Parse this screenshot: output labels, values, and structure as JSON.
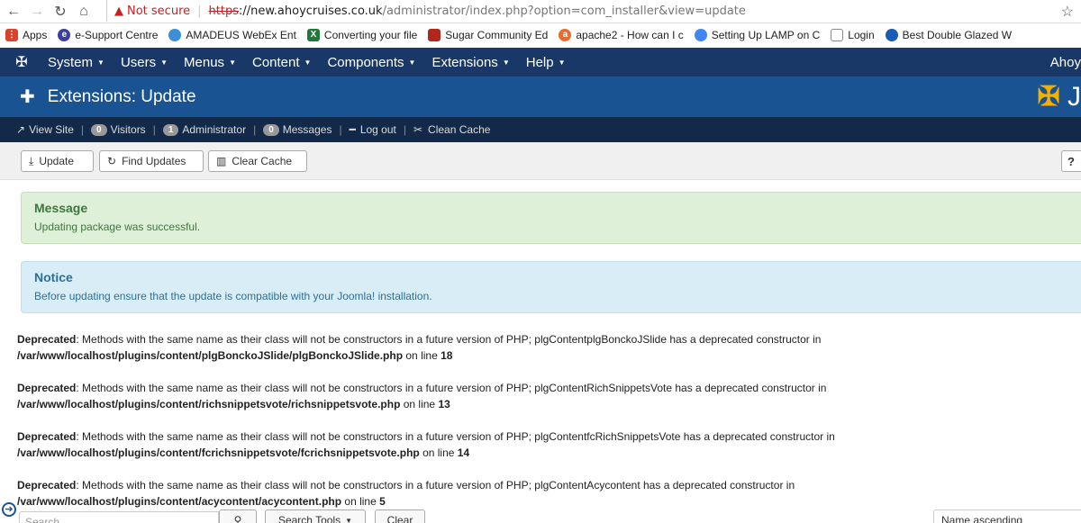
{
  "browser": {
    "security_label": "Not secure",
    "url_scheme": "https",
    "url_host": "://new.ahoycruises.co.uk",
    "url_path": "/administrator/index.php?option=com_installer&view=update"
  },
  "bookmarks": [
    {
      "label": "Apps",
      "icon": "apps-grid-icon",
      "color": "#d9432e"
    },
    {
      "label": "e-Support Centre",
      "icon": "e-icon",
      "color": "#3b3fa0"
    },
    {
      "label": "AMADEUS WebEx Ent",
      "icon": "webex-icon",
      "color": "#3a8fd6"
    },
    {
      "label": "Converting your file",
      "icon": "excel-icon",
      "color": "#1f7a3a"
    },
    {
      "label": "Sugar Community Ed",
      "icon": "sugar-icon",
      "color": "#b3261e"
    },
    {
      "label": "apache2 - How can I c",
      "icon": "askubuntu-icon",
      "color": "#e96c2b"
    },
    {
      "label": "Setting Up LAMP on C",
      "icon": "google-icon",
      "color": "#4285f4"
    },
    {
      "label": "Login",
      "icon": "page-icon",
      "color": "#ffffff"
    },
    {
      "label": "Best Double Glazed W",
      "icon": "eco-icon",
      "color": "#1a5bb5"
    }
  ],
  "topnav": {
    "items": [
      "System",
      "Users",
      "Menus",
      "Content",
      "Components",
      "Extensions",
      "Help"
    ],
    "right": "Ahoy"
  },
  "header": {
    "title": "Extensions: Update",
    "brand_letter": "J"
  },
  "status": {
    "view_site": "View Site",
    "visitors_count": "0",
    "visitors": "Visitors",
    "admin_count": "1",
    "administrator": "Administrator",
    "messages_count": "0",
    "messages": "Messages",
    "logout": "Log out",
    "clean_cache": "Clean Cache"
  },
  "toolbar": {
    "update": "Update",
    "find_updates": "Find Updates",
    "clear_cache": "Clear Cache"
  },
  "alerts": {
    "message_title": "Message",
    "message_text": "Updating package was successful.",
    "notice_title": "Notice",
    "notice_text": "Before updating ensure that the update is compatible with your Joomla! installation."
  },
  "deprecations": [
    {
      "label": "Deprecated",
      "text": ": Methods with the same name as their class will not be constructors in a future version of PHP; plgContentplgBonckoJSlide has a deprecated constructor in",
      "file": "/var/www/localhost/plugins/content/plgBonckoJSlide/plgBonckoJSlide.php",
      "online": " on line ",
      "line": "18"
    },
    {
      "label": "Deprecated",
      "text": ": Methods with the same name as their class will not be constructors in a future version of PHP; plgContentRichSnippetsVote has a deprecated constructor in",
      "file": "/var/www/localhost/plugins/content/richsnippetsvote/richsnippetsvote.php",
      "online": " on line ",
      "line": "13"
    },
    {
      "label": "Deprecated",
      "text": ": Methods with the same name as their class will not be constructors in a future version of PHP; plgContentfcRichSnippetsVote has a deprecated constructor in",
      "file": "/var/www/localhost/plugins/content/fcrichsnippetsvote/fcrichsnippetsvote.php",
      "online": " on line ",
      "line": "14"
    },
    {
      "label": "Deprecated",
      "text": ": Methods with the same name as their class will not be constructors in a future version of PHP; plgContentAcycontent has a deprecated constructor in",
      "file": "/var/www/localhost/plugins/content/acycontent/acycontent.php",
      "online": " on line ",
      "line": "5"
    }
  ],
  "filters": {
    "search_placeholder": "Search",
    "search_tools": "Search Tools",
    "clear": "Clear",
    "sort": "Name ascending"
  }
}
